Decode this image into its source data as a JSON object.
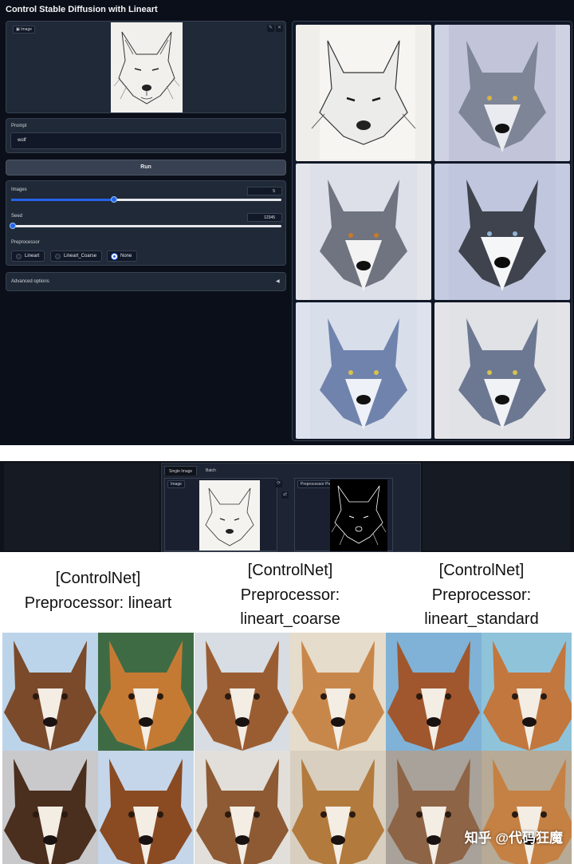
{
  "app": {
    "title": "Control Stable Diffusion with Lineart"
  },
  "image_input": {
    "label": "Image"
  },
  "prompt": {
    "label": "Prompt",
    "value": "wolf"
  },
  "run_button": {
    "label": "Run"
  },
  "images_slider": {
    "label": "Images",
    "value": "5",
    "fraction": 0.38
  },
  "seed_slider": {
    "label": "Seed",
    "value": "12345",
    "fraction": 0.0
  },
  "preprocessor": {
    "label": "Preprocessor",
    "options": [
      "Lineart",
      "Lineart_Coarse",
      "None"
    ],
    "selected": "None"
  },
  "advanced": {
    "label": "Advanced options",
    "caret": "◀"
  },
  "webui": {
    "tabs": [
      "Single Image",
      "Batch"
    ],
    "image_label": "Image",
    "preview_label": "Preprocessor Preview"
  },
  "captions": [
    {
      "line1": "[ControlNet]",
      "line2": "Preprocessor: lineart",
      "line3": ""
    },
    {
      "line1": "[ControlNet]",
      "line2": "Preprocessor:",
      "line3": "lineart_coarse"
    },
    {
      "line1": "[ControlNet]",
      "line2": "Preprocessor:",
      "line3": "lineart_standard"
    }
  ],
  "watermark": "知乎 @代码狂魔",
  "colors": {
    "accent": "#2563eb",
    "panel_bg": "#0b0f19",
    "block_bg": "#1f2937"
  }
}
